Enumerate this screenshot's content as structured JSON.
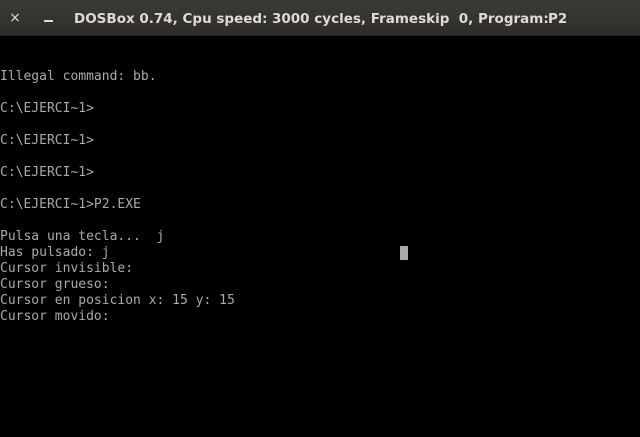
{
  "window": {
    "close_glyph": "×",
    "title_part1": "DOSBox 0.74, Cpu speed:",
    "title_part2": "3000 cycles, Frameskip  0, Program:",
    "title_part3": "P2"
  },
  "console": {
    "lines": [
      "Illegal command: bb.",
      "",
      "C:\\EJERCI~1>",
      "",
      "C:\\EJERCI~1>",
      "",
      "C:\\EJERCI~1>",
      "",
      "C:\\EJERCI~1>P2.EXE",
      "",
      "Pulsa una tecla...  j",
      "Has pulsado: j",
      "Cursor invisible:",
      "Cursor grueso:",
      "Cursor en posicion x: 15 y: 15",
      "Cursor movido:"
    ]
  },
  "colors": {
    "text": "#aaaaaa",
    "background": "#000000",
    "titlebar": "#3c3b37"
  }
}
